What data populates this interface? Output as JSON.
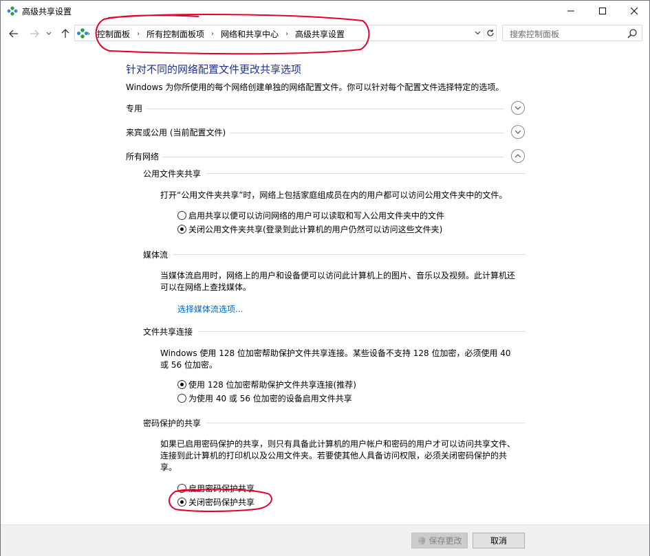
{
  "window": {
    "title": "高级共享设置"
  },
  "address_bar": {
    "crumbs": [
      "控制面板",
      "所有控制面板项",
      "网络和共享中心",
      "高级共享设置"
    ],
    "separator": "›"
  },
  "search": {
    "placeholder": "搜索控制面板"
  },
  "page": {
    "title": "针对不同的网络配置文件更改共享选项",
    "description": "Windows 为你所使用的每个网络创建单独的网络配置文件。你可以针对每个配置文件选择特定的选项。"
  },
  "profiles": [
    {
      "label": "专用",
      "state": "collapsed"
    },
    {
      "label": "来宾或公用 (当前配置文件)",
      "state": "collapsed"
    },
    {
      "label": "所有网络",
      "state": "expanded"
    }
  ],
  "public_folder": {
    "heading": "公用文件夹共享",
    "text": "打开“公用文件夹共享”时，网络上包括家庭组成员在内的用户都可以访问公用文件夹中的文件。",
    "options": [
      {
        "label": "启用共享以便可以访问网络的用户可以读取和写入公用文件夹中的文件",
        "checked": false
      },
      {
        "label": "关闭公用文件夹共享(登录到此计算机的用户仍然可以访问这些文件夹)",
        "checked": true
      }
    ]
  },
  "media": {
    "heading": "媒体流",
    "text": "当媒体流启用时，网络上的用户和设备便可以访问此计算机上的图片、音乐以及视频。此计算机还可以在网络上查找媒体。",
    "link": "选择媒体流选项..."
  },
  "file_sharing": {
    "heading": "文件共享连接",
    "text": "Windows 使用 128 位加密帮助保护文件共享连接。某些设备不支持 128 位加密，必须使用 40 或 56 位加密。",
    "options": [
      {
        "label": "使用 128 位加密帮助保护文件共享连接(推荐)",
        "checked": true
      },
      {
        "label": "为使用 40 或 56 位加密的设备启用文件共享",
        "checked": false
      }
    ]
  },
  "password": {
    "heading": "密码保护的共享",
    "text": "如果已启用密码保护的共享，则只有具备此计算机的用户帐户和密码的用户才可以访问共享文件、连接到此计算机的打印机以及公用文件夹。若要使其他人具备访问权限，必须关闭密码保护的共享。",
    "options": [
      {
        "label": "启用密码保护共享",
        "checked": false
      },
      {
        "label": "关闭密码保护共享",
        "checked": true
      }
    ]
  },
  "buttons": {
    "save": "保存更改",
    "cancel": "取消"
  },
  "colors": {
    "title_blue": "#1e3287",
    "link_blue": "#0066cc",
    "annotation_red": "#e4002b"
  }
}
